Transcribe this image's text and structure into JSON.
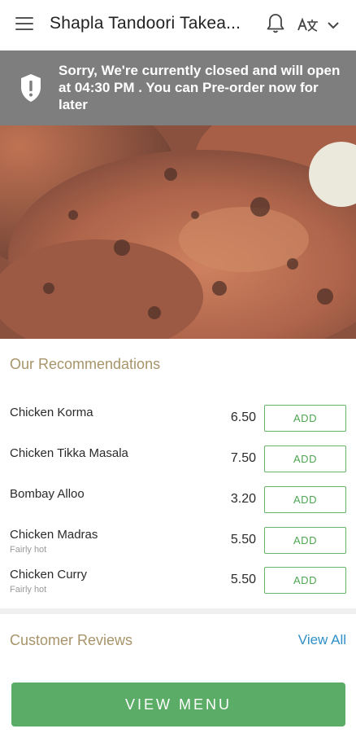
{
  "header": {
    "title": "Shapla Tandoori Takea...",
    "icons": [
      "menu-icon",
      "bell-icon",
      "language-icon",
      "chevron-down-icon"
    ]
  },
  "closed_banner": {
    "message": "Sorry, We're currently closed and will open at 04:30 PM . You can Pre-order now for later",
    "icon": "shield-alert-icon"
  },
  "recommendations": {
    "title": "Our Recommendations",
    "add_label": "ADD",
    "items": [
      {
        "name": "Chicken Korma",
        "subtitle": "",
        "price": "6.50"
      },
      {
        "name": "Chicken Tikka Masala",
        "subtitle": "",
        "price": "7.50"
      },
      {
        "name": "Bombay Alloo",
        "subtitle": "",
        "price": "3.20"
      },
      {
        "name": "Chicken Madras",
        "subtitle": "Fairly hot",
        "price": "5.50"
      },
      {
        "name": "Chicken Curry",
        "subtitle": "Fairly hot",
        "price": "5.50"
      }
    ]
  },
  "reviews": {
    "title": "Customer Reviews",
    "view_all_label": "View All"
  },
  "footer": {
    "view_menu_label": "VIEW MENU"
  },
  "colors": {
    "accent_green": "#5aac66",
    "section_title": "#a7946a",
    "link_blue": "#2f8fc7",
    "banner_gray": "#7e7e7e"
  }
}
